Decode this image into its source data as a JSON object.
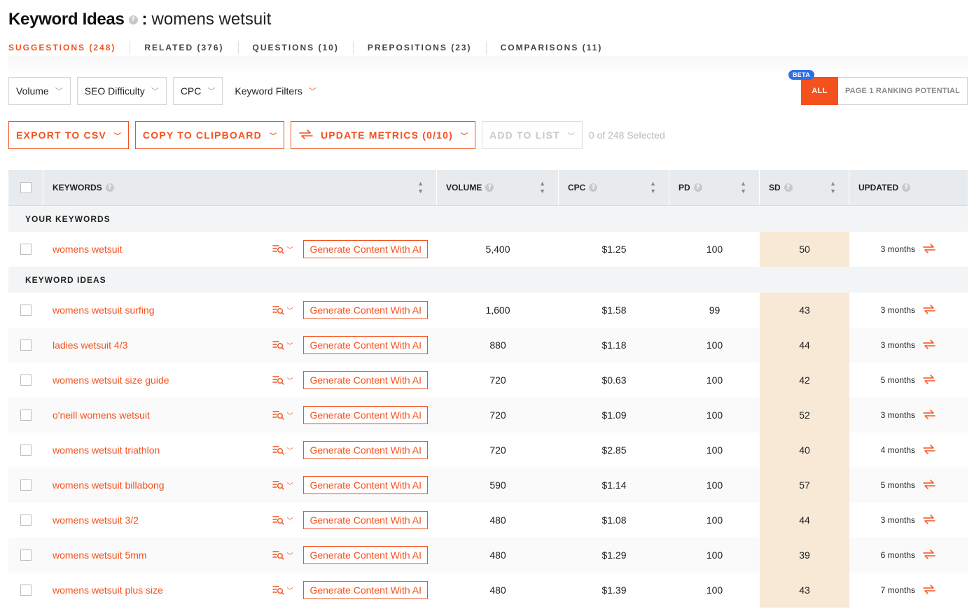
{
  "header": {
    "title": "Keyword Ideas",
    "help": "?",
    "separator": ":",
    "query": "womens wetsuit"
  },
  "tabs": [
    {
      "label": "SUGGESTIONS (248)",
      "active": true
    },
    {
      "label": "RELATED (376)",
      "active": false
    },
    {
      "label": "QUESTIONS (10)",
      "active": false
    },
    {
      "label": "PREPOSITIONS (23)",
      "active": false
    },
    {
      "label": "COMPARISONS (11)",
      "active": false
    }
  ],
  "filters": {
    "volume": "Volume",
    "seo_difficulty": "SEO Difficulty",
    "cpc": "CPC",
    "keyword_filters": "Keyword Filters",
    "chevron": "﹀"
  },
  "toggle": {
    "beta": "BETA",
    "all": "ALL",
    "page1": "PAGE 1 RANKING POTENTIAL"
  },
  "actions": {
    "export": "EXPORT TO CSV",
    "copy": "COPY TO CLIPBOARD",
    "update": "UPDATE METRICS (0/10)",
    "add_to_list": "ADD TO LIST",
    "selected": "0 of 248 Selected"
  },
  "table": {
    "columns": {
      "keywords": "KEYWORDS",
      "volume": "VOLUME",
      "cpc": "CPC",
      "pd": "PD",
      "sd": "SD",
      "updated": "UPDATED"
    },
    "sort_up": "▲",
    "sort_down": "▼",
    "your_keywords_label": "YOUR KEYWORDS",
    "keyword_ideas_label": "KEYWORD IDEAS",
    "generate_label": "Generate Content With AI",
    "your_keywords": [
      {
        "keyword": "womens wetsuit",
        "volume": "5,400",
        "cpc": "$1.25",
        "pd": "100",
        "sd": "50",
        "updated": "3 months"
      }
    ],
    "keyword_ideas": [
      {
        "keyword": "womens wetsuit surfing",
        "volume": "1,600",
        "cpc": "$1.58",
        "pd": "99",
        "sd": "43",
        "updated": "3 months"
      },
      {
        "keyword": "ladies wetsuit 4/3",
        "volume": "880",
        "cpc": "$1.18",
        "pd": "100",
        "sd": "44",
        "updated": "3 months"
      },
      {
        "keyword": "womens wetsuit size guide",
        "volume": "720",
        "cpc": "$0.63",
        "pd": "100",
        "sd": "42",
        "updated": "5 months"
      },
      {
        "keyword": "o'neill womens wetsuit",
        "volume": "720",
        "cpc": "$1.09",
        "pd": "100",
        "sd": "52",
        "updated": "3 months"
      },
      {
        "keyword": "womens wetsuit triathlon",
        "volume": "720",
        "cpc": "$2.85",
        "pd": "100",
        "sd": "40",
        "updated": "4 months"
      },
      {
        "keyword": "womens wetsuit billabong",
        "volume": "590",
        "cpc": "$1.14",
        "pd": "100",
        "sd": "57",
        "updated": "5 months"
      },
      {
        "keyword": "womens wetsuit 3/2",
        "volume": "480",
        "cpc": "$1.08",
        "pd": "100",
        "sd": "44",
        "updated": "3 months"
      },
      {
        "keyword": "womens wetsuit 5mm",
        "volume": "480",
        "cpc": "$1.29",
        "pd": "100",
        "sd": "39",
        "updated": "6 months"
      },
      {
        "keyword": "womens wetsuit plus size",
        "volume": "480",
        "cpc": "$1.39",
        "pd": "100",
        "sd": "43",
        "updated": "7 months"
      }
    ]
  },
  "colors": {
    "accent": "#f4511e",
    "beta": "#2f6fe4",
    "sd_highlight": "#f8e9d6",
    "header_bg": "#e8ebed"
  },
  "icons": {
    "help": "help-icon",
    "sync": "sync-icon",
    "keyword_search": "keyword-search-icon",
    "chevron": "chevron-down-icon",
    "sort": "sort-icon"
  }
}
